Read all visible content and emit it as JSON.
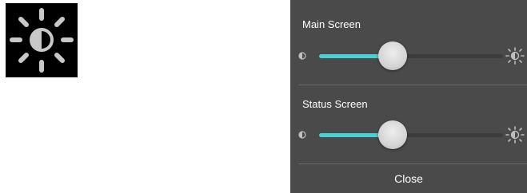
{
  "brightness_icon": {
    "icon": "brightness-icon"
  },
  "panel": {
    "main_screen": {
      "title": "Main Screen",
      "level_percent": 40,
      "min_icon": "brightness-low-icon",
      "max_icon": "brightness-high-icon"
    },
    "status_screen": {
      "title": "Status Screen",
      "level_percent": 40,
      "min_icon": "brightness-low-icon",
      "max_icon": "brightness-high-icon"
    },
    "close_label": "Close"
  },
  "colors": {
    "panel_bg": "#4a4a4a",
    "slider_fill": "#46d3d3",
    "slider_track": "#3c3c3c",
    "icon_tile_bg": "#000000"
  }
}
